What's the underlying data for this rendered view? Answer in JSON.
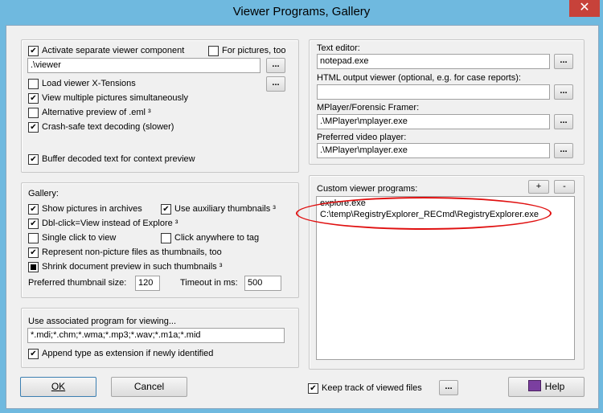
{
  "window": {
    "title": "Viewer Programs, Gallery",
    "close_label": "✕"
  },
  "viewer": {
    "activate_label": "Activate separate viewer component",
    "activate_checked": true,
    "for_pictures_label": "For pictures, too",
    "for_pictures_checked": false,
    "path_value": ".\\viewer",
    "browse_label": "...",
    "xtensions_label": "Load viewer X-Tensions",
    "xtensions_checked": false,
    "xtensions_btn_label": "...",
    "multiple_label": "View multiple pictures simultaneously",
    "multiple_checked": true,
    "alt_preview_label": "Alternative preview of .eml ³",
    "alt_preview_checked": false,
    "crashsafe_label": "Crash-safe text decoding (slower)",
    "crashsafe_checked": true,
    "buffer_label": "Buffer decoded text for context preview",
    "buffer_checked": true
  },
  "gallery": {
    "heading": "Gallery:",
    "archives_label": "Show pictures in archives",
    "archives_checked": true,
    "aux_label": "Use auxiliary thumbnails ³",
    "aux_checked": true,
    "dblclick_label": "Dbl-click=View instead of Explore ³",
    "dblclick_checked": true,
    "singleclick_label": "Single click to view",
    "singleclick_checked": false,
    "clickanywhere_label": "Click anywhere to tag",
    "clickanywhere_checked": false,
    "represent_label": "Represent non-picture files as thumbnails, too",
    "represent_checked": true,
    "shrink_label": "Shrink document preview in such thumbnails ³",
    "shrink_state": "indeterminate",
    "thumb_size_label": "Preferred thumbnail size:",
    "thumb_size_value": "120",
    "timeout_label": "Timeout in ms:",
    "timeout_value": "500"
  },
  "assoc": {
    "label": "Use associated program for viewing...",
    "value": "*.mdi;*.chm;*.wma;*.mp3;*.wav;*.m1a;*.mid",
    "append_label": "Append type as extension if newly identified",
    "append_checked": true
  },
  "editors": {
    "text_editor_label": "Text editor:",
    "text_editor_value": "notepad.exe",
    "html_viewer_label": "HTML output viewer (optional, e.g. for case reports):",
    "html_viewer_value": "",
    "mplayer_label": "MPlayer/Forensic Framer:",
    "mplayer_value": ".\\MPlayer\\mplayer.exe",
    "video_label": "Preferred video player:",
    "video_value": ".\\MPlayer\\mplayer.exe",
    "browse_label": "..."
  },
  "custom": {
    "label": "Custom viewer programs:",
    "add_label": "+",
    "remove_label": "-",
    "lines": [
      "explore.exe",
      "C:\\temp\\RegistryExplorer_RECmd\\RegistryExplorer.exe"
    ]
  },
  "footer": {
    "ok_label": "OK",
    "cancel_label": "Cancel",
    "keep_track_label": "Keep track of viewed files",
    "keep_track_checked": true,
    "keep_track_btn_label": "...",
    "help_label": "Help",
    "help_icon": "help-book-icon"
  },
  "colors": {
    "title_bar": "#6fb9df",
    "close_button": "#c7423a",
    "highlight_ring": "#e01010"
  }
}
